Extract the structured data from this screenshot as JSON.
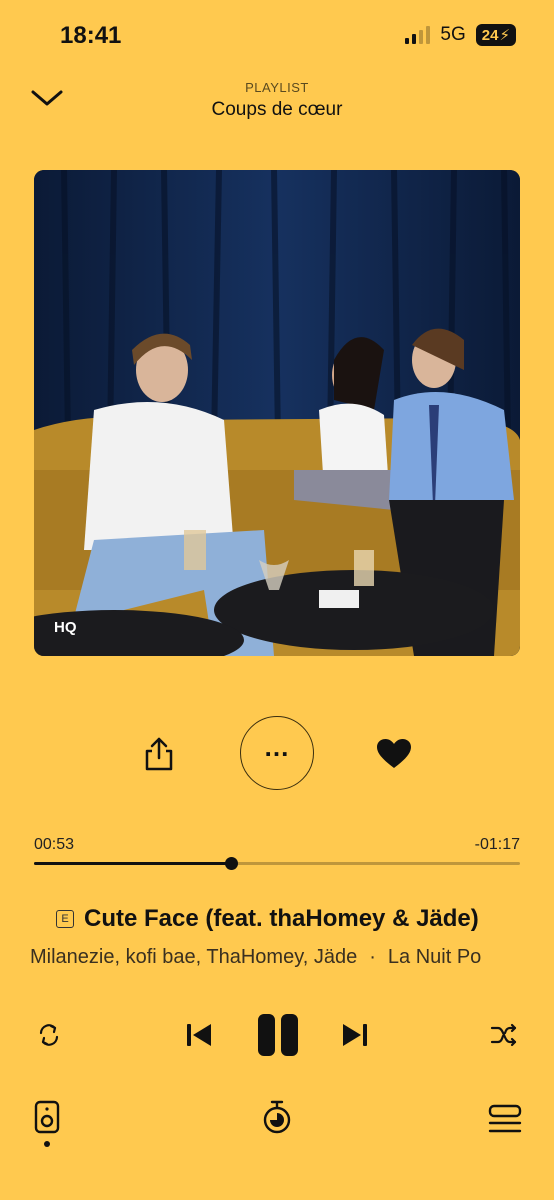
{
  "status": {
    "time": "18:41",
    "network": "5G",
    "battery": "24"
  },
  "header": {
    "kicker": "PLAYLIST",
    "title": "Coups de cœur"
  },
  "artwork": {
    "badge": "HQ"
  },
  "progress": {
    "elapsed": "00:53",
    "remaining": "-01:17",
    "fraction": 0.405
  },
  "song": {
    "explicit": "E",
    "title": "Cute Face (feat. thaHomey & Jäde)",
    "artists": "Milanezie, kofi bae, ThaHomey, Jäde",
    "separator": "·",
    "album": "La Nuit Po"
  },
  "icons": {
    "chevron": "chevron-down-icon",
    "share": "share-icon",
    "more": "more-icon",
    "heart": "heart-icon",
    "repeat": "repeat-icon",
    "prev": "previous-icon",
    "pause": "pause-icon",
    "next": "next-icon",
    "shuffle": "shuffle-icon",
    "speaker": "speaker-icon",
    "timer": "timer-icon",
    "queue": "queue-icon"
  },
  "colors": {
    "background": "#FFC94F",
    "foreground": "#111111"
  }
}
